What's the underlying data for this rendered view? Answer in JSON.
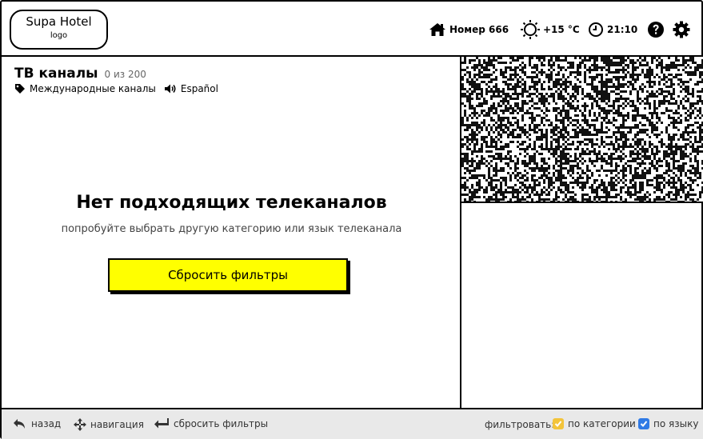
{
  "header": {
    "logo_title": "Supa Hotel",
    "logo_sub": "logo",
    "room_label": "Номер 666",
    "temperature": "+15 °C",
    "time": "21:10",
    "icons": [
      "home-icon",
      "sun-icon",
      "clock-icon",
      "help-icon",
      "gear-icon"
    ]
  },
  "main": {
    "title": "ТВ каналы",
    "count": "0 из 200",
    "category_filter": "Международные каналы",
    "language_filter": "Español",
    "empty_title": "Нет подходящих телеканалов",
    "empty_subtitle": "попробуйте выбрать другую категорию или язык телеканала",
    "reset_button": "Сбросить фильтры"
  },
  "footer": {
    "back": "назад",
    "navigation": "навигация",
    "reset_filters": "сбросить фильтры",
    "filter_label": "фильтровать:",
    "by_category": "по категории",
    "by_language": "по языку",
    "by_category_checked": true,
    "by_language_checked": true
  },
  "colors": {
    "accent": "#ffff00",
    "category_check": "#f3c43a",
    "language_check": "#2f7ae5",
    "footer_bg": "#e9e9e9"
  }
}
